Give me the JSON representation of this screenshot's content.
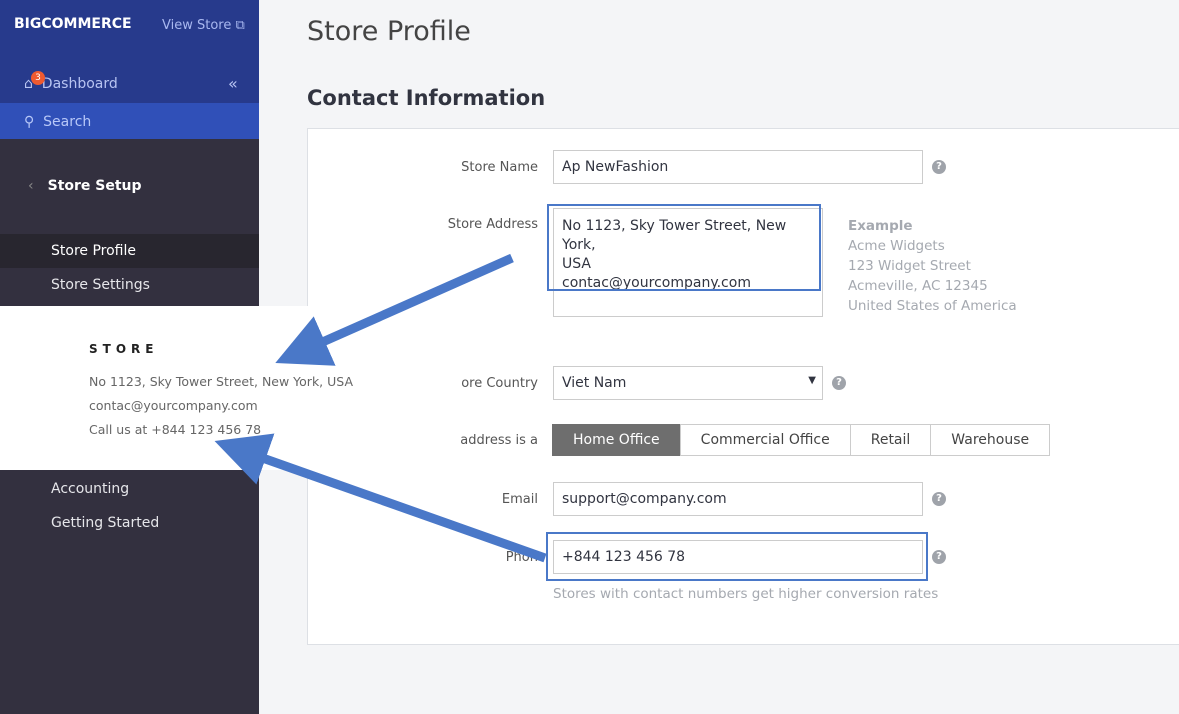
{
  "sidebar": {
    "logo": "BIGCOMMERCE",
    "view_store": "View Store",
    "dashboard": "Dashboard",
    "badge": "3",
    "search": "Search",
    "section": "Store Setup",
    "items": [
      "Store Profile",
      "Store Settings",
      "Accounting",
      "Getting Started"
    ]
  },
  "page": {
    "title": "Store Profile",
    "section": "Contact Information"
  },
  "form": {
    "store_name_label": "Store Name",
    "store_name": "Ap NewFashion",
    "address_label": "Store Address",
    "address_lines": [
      "No 1123, Sky Tower Street, New York,",
      "USA",
      "contac@yourcompany.com"
    ],
    "example_title": "Example",
    "example_lines": [
      "Acme Widgets",
      "123 Widget Street",
      "Acmeville, AC 12345",
      "United States of America"
    ],
    "country_label": "ore Country",
    "country": "Viet Nam",
    "type_label": "address is a",
    "types": [
      "Home Office",
      "Commercial Office",
      "Retail",
      "Warehouse"
    ],
    "selected_type": "Home Office",
    "email_label": "Email",
    "email": "support@company.com",
    "phone_label": "Phon",
    "phone": "+844 123 456 78",
    "phone_hint": "Stores with contact numbers get higher conversion rates",
    "help": "?"
  },
  "overlay": {
    "title": "STORE",
    "lines": [
      "No 1123, Sky Tower Street, New York, USA",
      "contac@yourcompany.com",
      "Call us at +844 123 456 78"
    ]
  },
  "colors": {
    "sidebar_top": "#273a8c",
    "search": "#3050b8",
    "sidebar": "#33303f",
    "arrow": "#4a78c8"
  }
}
